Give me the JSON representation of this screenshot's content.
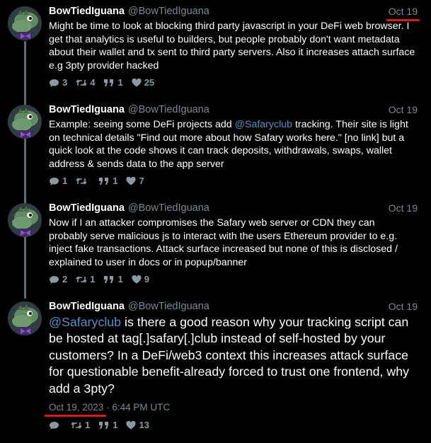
{
  "thread": {
    "tweets": [
      {
        "name": "BowTiedIguana",
        "handle": "@BowTiedIguana",
        "date": "Oct 19",
        "text": "Might be time to look at blocking third party javascript in  your DeFi web browser. I get that analytics is useful to builders, but people probably don't want metadata about their wallet and tx sent to third party servers. Also it increases attach surface e.g 3pty provider hacked",
        "replies": "3",
        "retweets": "4",
        "quotes": "1",
        "likes": "25"
      },
      {
        "name": "BowTiedIguana",
        "handle": "@BowTiedIguana",
        "date": "Oct 19",
        "text_before": "Example: seeing some DeFi projects add ",
        "mention": "@Safaryclub",
        "text_after": " tracking. Their site is light on technical details \"Find out more about how Safary works here.\" [no link] but a quick look at the code shows it can track deposits, withdrawals, swaps, wallet address & sends data to the app server",
        "replies": "1",
        "retweets": "",
        "quotes": "1",
        "likes": "7"
      },
      {
        "name": "BowTiedIguana",
        "handle": "@BowTiedIguana",
        "date": "Oct 19",
        "text": "Now if I an attacker compromises the Safary web server or CDN they can probably serve malicious js to interact with the users Ethereum provider to e.g. inject fake transactions. Attack surface increased but none of this is disclosed / explained to user in docs or in popup/banner",
        "replies": "2",
        "retweets": "1",
        "quotes": "1",
        "likes": "9"
      },
      {
        "name": "BowTiedIguana",
        "handle": "@BowTiedIguana",
        "date": "Oct 19",
        "mention": "@Safaryclub",
        "text_after": " is there a good reason why your tracking script can be hosted at tag[.]safary[.]club instead of self-hosted by your customers? In a DeFi/web3 context this increases attack surface for questionable benefit-already forced to trust one frontend, why add a 3pty?",
        "timestamp_date": "Oct 19, 2023",
        "timestamp_sep": " · ",
        "timestamp_time": "6:44 PM UTC",
        "replies": "",
        "retweets": "1",
        "quotes": "1",
        "likes": "13"
      }
    ]
  },
  "icons": {
    "reply": "speech-bubble-icon",
    "retweet": "retweet-arrows-icon",
    "quote": "quote-marks-icon",
    "like": "heart-icon"
  },
  "colors": {
    "background": "#000000",
    "text": "#ffffff",
    "muted": "#7b8a8f",
    "link": "#5b8ec4",
    "annotation": "#e0171b",
    "thread_line": "#5e6d72"
  }
}
